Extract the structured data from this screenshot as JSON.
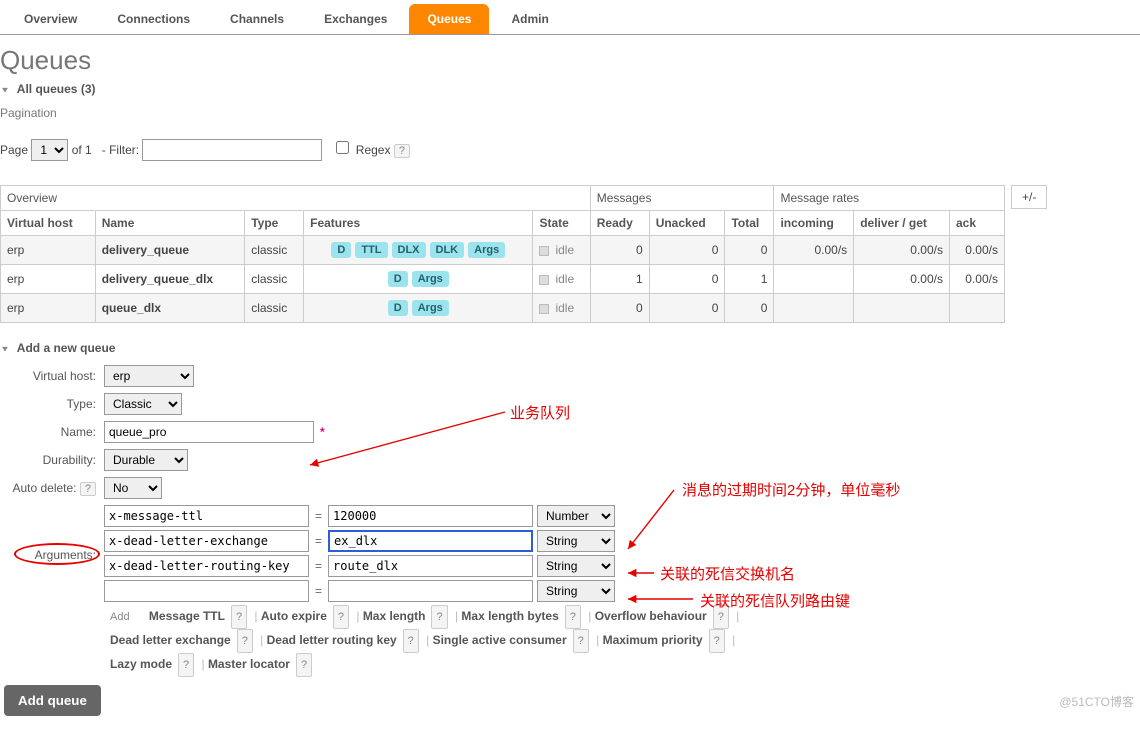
{
  "tabs": {
    "overview": "Overview",
    "connections": "Connections",
    "channels": "Channels",
    "exchanges": "Exchanges",
    "queues": "Queues",
    "admin": "Admin"
  },
  "page_title": "Queues",
  "all_queues": {
    "label": "All queues",
    "count": "(3)"
  },
  "pagination": {
    "section": "Pagination",
    "page_lbl": "Page",
    "page_val": "1",
    "of": "of 1",
    "filter": "- Filter:",
    "regex": "Regex"
  },
  "tbl": {
    "groups": {
      "overview": "Overview",
      "messages": "Messages",
      "rates": "Message rates",
      "plusminus": "+/-"
    },
    "cols": {
      "vhost": "Virtual host",
      "name": "Name",
      "type": "Type",
      "features": "Features",
      "state": "State",
      "ready": "Ready",
      "unacked": "Unacked",
      "total": "Total",
      "incoming": "incoming",
      "deliver": "deliver / get",
      "ack": "ack"
    },
    "rows": [
      {
        "vhost": "erp",
        "name": "delivery_queue",
        "type": "classic",
        "feats": [
          "D",
          "TTL",
          "DLX",
          "DLK",
          "Args"
        ],
        "state": "idle",
        "ready": "0",
        "unacked": "0",
        "total": "0",
        "incoming": "0.00/s",
        "deliver": "0.00/s",
        "ack": "0.00/s"
      },
      {
        "vhost": "erp",
        "name": "delivery_queue_dlx",
        "type": "classic",
        "feats": [
          "D",
          "Args"
        ],
        "state": "idle",
        "ready": "1",
        "unacked": "0",
        "total": "1",
        "incoming": "",
        "deliver": "0.00/s",
        "ack": "0.00/s"
      },
      {
        "vhost": "erp",
        "name": "queue_dlx",
        "type": "classic",
        "feats": [
          "D",
          "Args"
        ],
        "state": "idle",
        "ready": "0",
        "unacked": "0",
        "total": "0",
        "incoming": "",
        "deliver": "",
        "ack": ""
      }
    ]
  },
  "add": {
    "title": "Add a new queue",
    "labels": {
      "vhost": "Virtual host:",
      "type": "Type:",
      "name": "Name:",
      "durability": "Durability:",
      "auto_delete": "Auto delete:",
      "arguments": "Arguments:"
    },
    "vals": {
      "vhost": "erp",
      "type": "Classic",
      "name": "queue_pro",
      "durability": "Durable",
      "auto_delete": "No"
    },
    "args": [
      {
        "k": "x-message-ttl",
        "v": "120000",
        "t": "Number"
      },
      {
        "k": "x-dead-letter-exchange",
        "v": "ex_dlx",
        "t": "String"
      },
      {
        "k": "x-dead-letter-routing-key",
        "v": "route_dlx",
        "t": "String"
      },
      {
        "k": "",
        "v": "",
        "t": "String"
      }
    ],
    "add_word": "Add",
    "tags": [
      "Message TTL",
      "Auto expire",
      "Max length",
      "Max length bytes",
      "Overflow behaviour",
      "Dead letter exchange",
      "Dead letter routing key",
      "Single active consumer",
      "Maximum priority",
      "Lazy mode",
      "Master locator"
    ],
    "button": "Add queue"
  },
  "anno": {
    "a1": "业务队列",
    "a2": "消息的过期时间2分钟，单位毫秒",
    "a3": "关联的死信交换机名",
    "a4": "关联的死信队列路由键"
  },
  "watermark": "@51CTO博客"
}
